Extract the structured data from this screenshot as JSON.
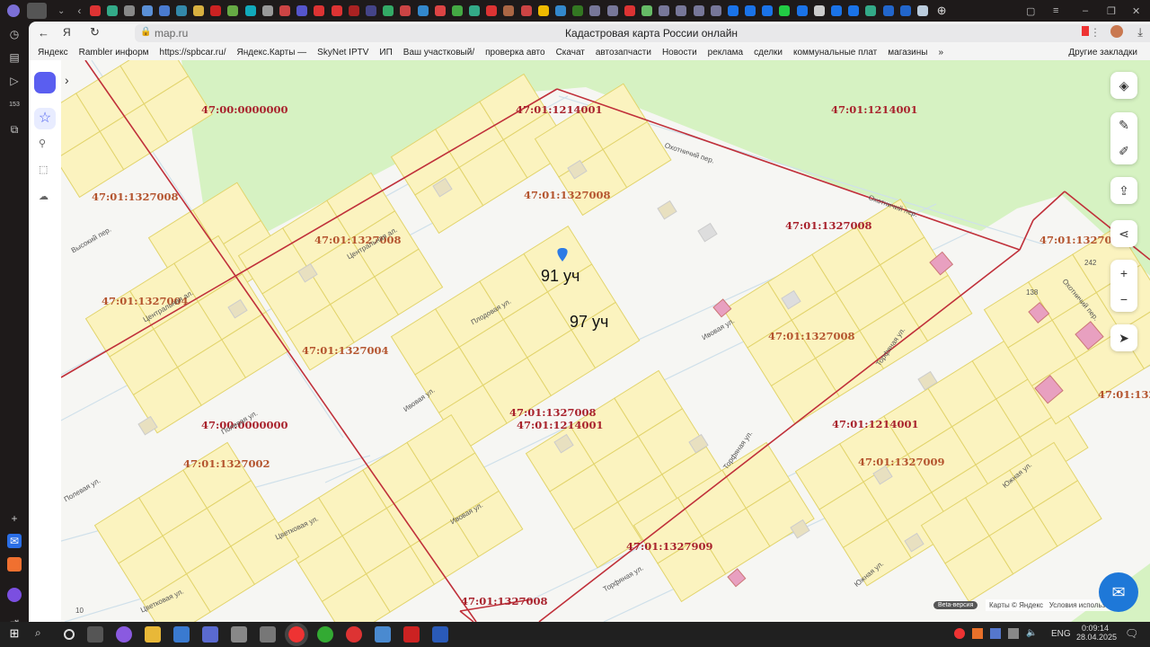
{
  "browser": {
    "url": "map.ru",
    "page_title": "Кадастровая карта России онлайн",
    "tab_icon_colors": [
      "#d33",
      "#3a8",
      "#888",
      "#5a8fd6",
      "#4a7bd0",
      "#38a",
      "#d8b040",
      "#c22",
      "#6a4",
      "#1ab",
      "#999",
      "#c44",
      "#55c",
      "#d33",
      "#d33",
      "#a22",
      "#448",
      "#3a6",
      "#c44",
      "#38c",
      "#d44",
      "#4a4",
      "#3a8",
      "#d33",
      "#a64",
      "#c44",
      "#eb0",
      "#38c",
      "#372",
      "#779",
      "#779",
      "#d33",
      "#6b6",
      "#779",
      "#779",
      "#779",
      "#779",
      "#1a73e8",
      "#1a73e8",
      "#1a73e8",
      "#2c4",
      "#1a73e8",
      "#ccc",
      "#1a73e8",
      "#1a73e8",
      "#3a8",
      "#26c",
      "#26c",
      "#bcd"
    ],
    "bookmarks": [
      "Яндекс",
      "Rambler информ",
      "https://spbcar.ru/",
      "Яндекс.Карты —",
      "SkyNet IPTV",
      "ИП",
      "Ваш участковый/",
      "проверка авто",
      "Скачат",
      "автозапчасти",
      "Новости",
      "реклама",
      "сделки",
      "коммунальные плат",
      "магазины",
      "»",
      "Другие закладки"
    ]
  },
  "map": {
    "cadastral_labels": [
      "47:00:0000000",
      "47:01:1214001",
      "47:01:1214001",
      "47:01:1327008",
      "47:01:1327004",
      "47:01:1327008",
      "47:01:1327008",
      "47:01:132700",
      "47:01:1327004",
      "47:01:1327008",
      "47:01:1327008",
      "47:01:1327008",
      "47:01:1214001",
      "47:00:0000000",
      "47:01:1214001",
      "47:01:1327009",
      "47:01:1327002",
      "47:01:1327909",
      "47:01:1327008",
      "47:01:132"
    ],
    "streets": [
      "Охотничий пер.",
      "Охотничий пер.",
      "Охотничий пер.",
      "Центральная ал.",
      "Высокий пер.",
      "Плодовая ул.",
      "Центральная ал.",
      "Ивовая ул.",
      "Ивовая ул.",
      "Ивовая ул.",
      "Торфяная ул.",
      "Торфяная ул.",
      "Торфяная ул.",
      "Южная ул.",
      "Южная ул.",
      "Полевая ул.",
      "Полевая ул.",
      "Цветковая ул.",
      "Цветковая ул."
    ],
    "house_numbers": [
      "138",
      "242",
      "10"
    ],
    "annotations": [
      "91 уч",
      "97 уч"
    ],
    "beta": "Beta-версия",
    "copyright": "Карты © Яндекс",
    "terms": "Условия использ",
    "colors": {
      "boundary": "#c0303a",
      "parcel": "#fbf3bf",
      "parcel_stroke": "#e2d46c",
      "forest": "#d6f2c2",
      "building_registered": "#e8a0c0"
    }
  },
  "taskbar": {
    "lang": "ENG",
    "time": "0:09:14",
    "date": "28.04.2025",
    "notifications": "1"
  }
}
